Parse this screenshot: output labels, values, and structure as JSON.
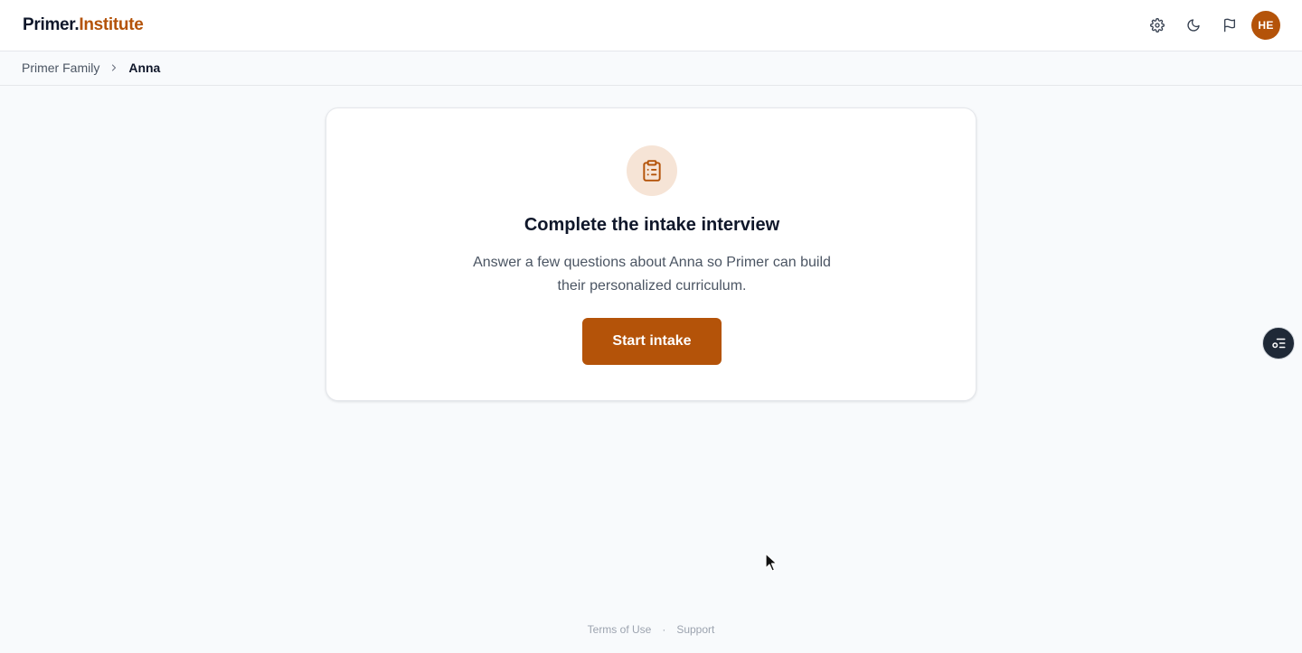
{
  "header": {
    "logo_part1": "Primer.",
    "logo_part2": "Institute",
    "avatar_initials": "HE",
    "icons": [
      "gear-icon",
      "moon-icon",
      "flag-icon"
    ]
  },
  "breadcrumb": {
    "parent": "Primer Family",
    "current": "Anna"
  },
  "card": {
    "icon": "clipboard-icon",
    "title": "Complete the intake interview",
    "description": "Answer a few questions about Anna so Primer can build their personalized curriculum.",
    "button_label": "Start intake"
  },
  "floating_button": {
    "icon": "task-list-icon"
  },
  "footer": {
    "terms": "Terms of Use",
    "separator": "·",
    "support": "Support"
  },
  "colors": {
    "accent": "#b45309",
    "icon_bg": "#f6e4d6",
    "background": "#f8fafc"
  }
}
